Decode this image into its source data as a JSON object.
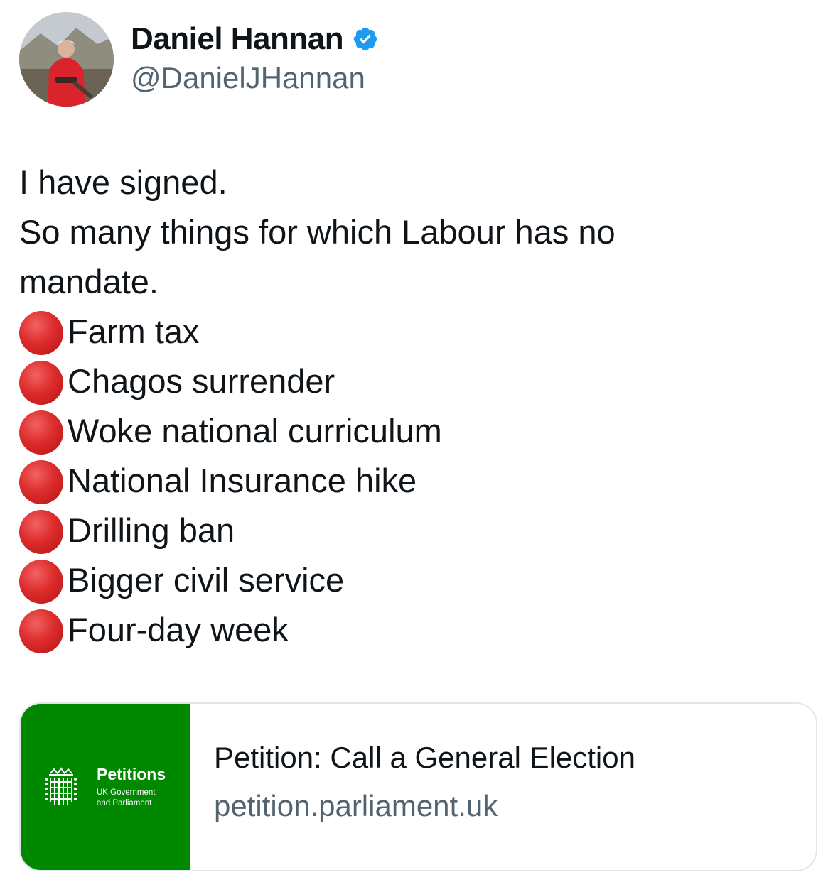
{
  "author": {
    "display_name": "Daniel Hannan",
    "handle": "@DanielJHannan",
    "verified_icon": "verified-badge-icon",
    "badge_color": "#1d9bf0"
  },
  "tweet": {
    "lines": [
      "I have signed.",
      "So many things for which Labour has no",
      "mandate."
    ],
    "bullet_icon": "red-circle-icon",
    "bullets": [
      "Farm tax",
      "Chagos surrender",
      "Woke national curriculum",
      "National Insurance hike",
      "Drilling ban",
      "Bigger civil service",
      "Four-day week"
    ]
  },
  "link_card": {
    "thumb_title": "Petitions",
    "thumb_subtitle_1": "UK Government",
    "thumb_subtitle_2": "and Parliament",
    "thumb_color": "#008800",
    "title": "Petition: Call a General Election",
    "domain": "petition.parliament.uk"
  },
  "colors": {
    "text_primary": "#0f1419",
    "text_secondary": "#536471",
    "bullet_red": "#dd2c2c"
  }
}
